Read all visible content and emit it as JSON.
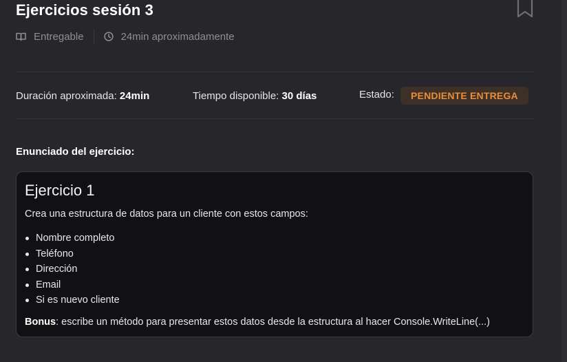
{
  "header": {
    "title": "Ejercicios sesión 3",
    "bookmark_icon": "bookmark-icon",
    "meta": [
      {
        "icon": "book-open-icon",
        "label": "Entregable"
      },
      {
        "icon": "clock-icon",
        "label": "24min aproximadamente"
      }
    ]
  },
  "info": {
    "duration_label": "Duración aproximada:",
    "duration_value": "24min",
    "available_label": "Tiempo disponible:",
    "available_value": "30 días",
    "status_label": "Estado:",
    "status_value": "PENDIENTE ENTREGA",
    "status_color": "#e88d3a"
  },
  "exercise": {
    "section_label": "Enunciado del ejercicio:",
    "title": "Ejercicio 1",
    "description": "Crea una estructura de datos para un cliente con estos campos:",
    "fields": [
      "Nombre completo",
      "Teléfono",
      "Dirección",
      "Email",
      "Si es nuevo cliente"
    ],
    "bonus_label": "Bonus",
    "bonus_text": ": escribe un método para presentar estos datos desde la estructura al hacer Console.WriteLine(...)"
  },
  "colors": {
    "background": "#27272b",
    "card": "#111113",
    "accent": "#e88d3a"
  }
}
